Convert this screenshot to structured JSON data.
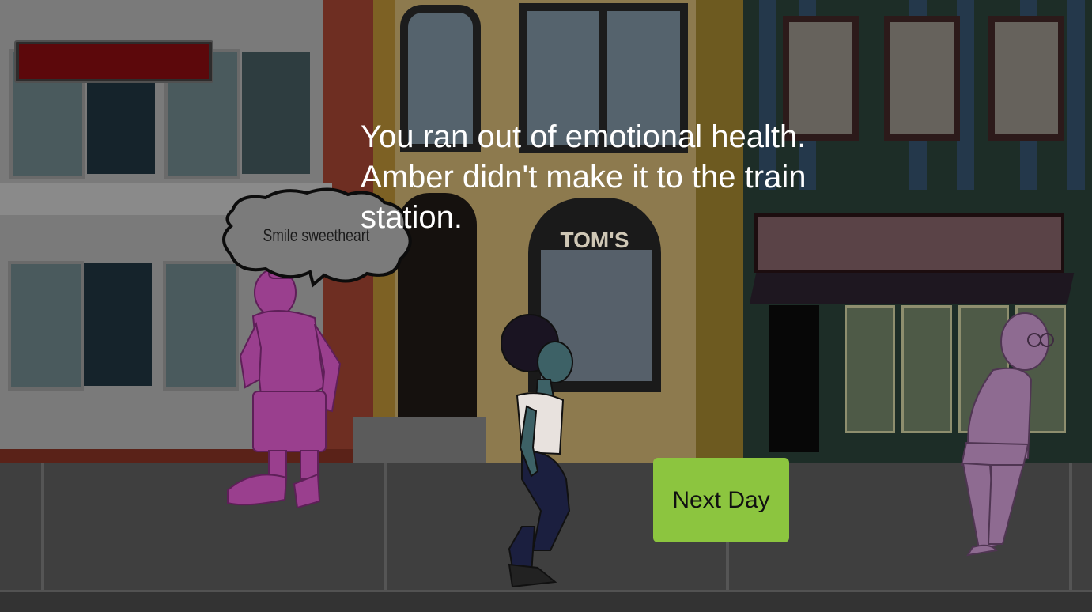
{
  "game": {
    "health": {
      "label": "emotional health",
      "value": 1.0,
      "fill_color": "#5c080b"
    },
    "message": "You ran out of emotional health. Amber didn't make it to the train station.",
    "speech_bubble": "Smile sweetheart",
    "shop_sign": "TOM'S",
    "next_day_button": "Next Day",
    "colors": {
      "button": "#8cc53f",
      "harasser": "#9a3f8e",
      "amber_skin": "#3d6166",
      "old_man": "#8e6b91"
    },
    "characters": [
      "harasser",
      "amber",
      "old-man"
    ]
  }
}
